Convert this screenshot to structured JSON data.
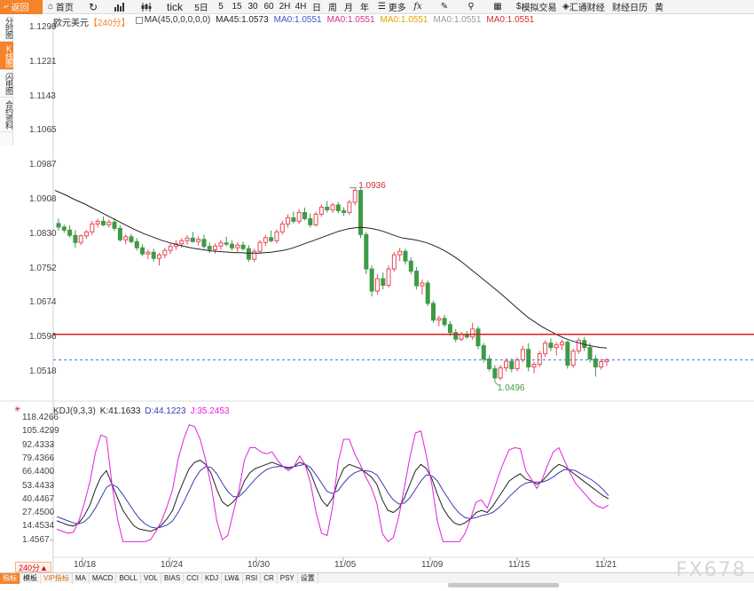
{
  "toolbar": {
    "back_label": "返回",
    "home_label": "首页",
    "tick_label": "tick",
    "periods": [
      "5日",
      "5",
      "15",
      "30",
      "60",
      "2H",
      "4H",
      "日",
      "周",
      "月",
      "年"
    ],
    "more_label": "更多",
    "fx_label": "fx",
    "sim_trade_label": "模拟交易",
    "huitong_label": "汇通财经",
    "calendar_label": "财经日历",
    "cut_label": "黄"
  },
  "sidebar": {
    "tabs": [
      "分时图",
      "K线图",
      "闪电图",
      "合约资料"
    ],
    "active_index": 1
  },
  "main_info": {
    "symbol": "欧元美元",
    "period": "【240分】",
    "ma_label": "MA(45,0,0,0,0,0)",
    "ma45": "MA45:1.0573",
    "ma0_1": "MA0:1.0551",
    "ma0_2": "MA0:1.0551",
    "ma0_3": "MA0:1.0551",
    "ma0_4": "MA0:1.0551",
    "ma0_5": "MA0:1.0551",
    "colors": {
      "ma45": "#222222",
      "ma0_1": "#3a56c5",
      "ma0_2": "#d0309a",
      "ma0_3": "#e5a000",
      "ma0_4": "#9a9a9a",
      "ma0_5": "#d03030"
    }
  },
  "kdj_info": {
    "name": "KDJ(9,3,3)",
    "k": "K:41.1633",
    "d": "D:44.1223",
    "j": "J:35.2453",
    "colors": {
      "k": "#222222",
      "d": "#3a3ab0",
      "j": "#e020e0"
    }
  },
  "price_axis": [
    "1.1299",
    "1.1221",
    "1.1143",
    "1.1065",
    "1.0987",
    "1.0908",
    "1.0830",
    "1.0752",
    "1.0674",
    "1.0596",
    "1.0518"
  ],
  "kdj_axis": [
    "118.4266",
    "105.4299",
    "92.4333",
    "79.4366",
    "66.4400",
    "53.4433",
    "40.4467",
    "27.4500",
    "14.4534",
    "1.4567"
  ],
  "date_axis": [
    "10/18",
    "10/24",
    "10/30",
    "11/05",
    "11/09",
    "11/15",
    "11/21"
  ],
  "annotations": {
    "high": "1.0936",
    "low": "1.0496"
  },
  "bottom_tabs": [
    "指标",
    "模板",
    "VIP指标",
    "MA",
    "MACD",
    "BOLL",
    "VOL",
    "BIAS",
    "CCI",
    "KDJ",
    "LW&",
    "RSI",
    "CR",
    "PSY",
    "设置"
  ],
  "period_tab": "240分▲",
  "watermark": "FX678",
  "colors": {
    "accent": "#f4832a",
    "up": "#e8485a",
    "down": "#3f9a45",
    "hline": "#d62020",
    "dashline": "#3a7fd0"
  },
  "chart_data": [
    {
      "type": "candlestick",
      "series_name": "欧元美元",
      "y_range": [
        1.0496,
        1.1299
      ],
      "high": 1.0936,
      "low": 1.0496,
      "horizontal_line": 1.0604,
      "dashed_line": 1.0546,
      "ohlc": [
        [
          1.0855,
          1.0866,
          1.0839,
          1.0847
        ],
        [
          1.0847,
          1.0852,
          1.0834,
          1.084
        ],
        [
          1.084,
          1.0851,
          1.0823,
          1.0828
        ],
        [
          1.0828,
          1.084,
          1.08,
          1.0812
        ],
        [
          1.0812,
          1.083,
          1.0806,
          1.0827
        ],
        [
          1.0827,
          1.084,
          1.082,
          1.0836
        ],
        [
          1.0836,
          1.0861,
          1.0829,
          1.0854
        ],
        [
          1.0854,
          1.0866,
          1.0846,
          1.086
        ],
        [
          1.086,
          1.0871,
          1.0849,
          1.0852
        ],
        [
          1.0852,
          1.0864,
          1.0846,
          1.0858
        ],
        [
          1.0858,
          1.0867,
          1.0838,
          1.0844
        ],
        [
          1.0844,
          1.0851,
          1.0814,
          1.0818
        ],
        [
          1.0818,
          1.0831,
          1.0808,
          1.0825
        ],
        [
          1.0825,
          1.0832,
          1.081,
          1.0814
        ],
        [
          1.0814,
          1.0822,
          1.0794,
          1.08
        ],
        [
          1.08,
          1.0808,
          1.0781,
          1.0786
        ],
        [
          1.0786,
          1.0796,
          1.0774,
          1.079
        ],
        [
          1.079,
          1.0798,
          1.0769,
          1.0776
        ],
        [
          1.0776,
          1.0788,
          1.076,
          1.0784
        ],
        [
          1.0784,
          1.08,
          1.0776,
          1.0794
        ],
        [
          1.0794,
          1.081,
          1.0786,
          1.0803
        ],
        [
          1.0803,
          1.0817,
          1.0795,
          1.0809
        ],
        [
          1.0809,
          1.0822,
          1.08,
          1.0816
        ],
        [
          1.0816,
          1.0829,
          1.0807,
          1.0822
        ],
        [
          1.0822,
          1.0836,
          1.0812,
          1.0814
        ],
        [
          1.0814,
          1.0826,
          1.0805,
          1.0819
        ],
        [
          1.0819,
          1.083,
          1.0798,
          1.0803
        ],
        [
          1.0803,
          1.0812,
          1.0788,
          1.0796
        ],
        [
          1.0796,
          1.081,
          1.0787,
          1.0804
        ],
        [
          1.0804,
          1.0818,
          1.0795,
          1.0811
        ],
        [
          1.0811,
          1.0825,
          1.0803,
          1.0808
        ],
        [
          1.0808,
          1.0817,
          1.0794,
          1.08
        ],
        [
          1.08,
          1.0812,
          1.079,
          1.0806
        ],
        [
          1.0806,
          1.0814,
          1.0794,
          1.0798
        ],
        [
          1.0798,
          1.0806,
          1.0768,
          1.0774
        ],
        [
          1.0774,
          1.0798,
          1.0768,
          1.0792
        ],
        [
          1.0792,
          1.0818,
          1.0786,
          1.0812
        ],
        [
          1.0812,
          1.0829,
          1.0804,
          1.0823
        ],
        [
          1.0823,
          1.0839,
          1.0812,
          1.0816
        ],
        [
          1.0816,
          1.0842,
          1.081,
          1.0836
        ],
        [
          1.0836,
          1.0861,
          1.083,
          1.0854
        ],
        [
          1.0854,
          1.0876,
          1.0846,
          1.0868
        ],
        [
          1.0868,
          1.0882,
          1.0855,
          1.086
        ],
        [
          1.086,
          1.0888,
          1.0854,
          1.088
        ],
        [
          1.088,
          1.0891,
          1.0862,
          1.0866
        ],
        [
          1.0866,
          1.0878,
          1.0846,
          1.0852
        ],
        [
          1.0852,
          1.0882,
          1.0848,
          1.0876
        ],
        [
          1.0876,
          1.0898,
          1.087,
          1.0892
        ],
        [
          1.0892,
          1.0906,
          1.088,
          1.0886
        ],
        [
          1.0886,
          1.0902,
          1.0879,
          1.0897
        ],
        [
          1.0897,
          1.0904,
          1.0878,
          1.0884
        ],
        [
          1.0884,
          1.0892,
          1.0872,
          1.088
        ],
        [
          1.088,
          1.0908,
          1.0875,
          1.0903
        ],
        [
          1.0903,
          1.0936,
          1.0896,
          1.093
        ],
        [
          1.093,
          1.0934,
          1.0822,
          1.083
        ],
        [
          1.083,
          1.0836,
          1.074,
          1.0752
        ],
        [
          1.0752,
          1.076,
          1.069,
          1.0702
        ],
        [
          1.0702,
          1.074,
          1.0694,
          1.073
        ],
        [
          1.073,
          1.0744,
          1.0706,
          1.0715
        ],
        [
          1.0715,
          1.076,
          1.071,
          1.0752
        ],
        [
          1.0752,
          1.079,
          1.0746,
          1.0784
        ],
        [
          1.0784,
          1.08,
          1.077,
          1.0792
        ],
        [
          1.0792,
          1.0798,
          1.0762,
          1.077
        ],
        [
          1.077,
          1.0778,
          1.074,
          1.0747
        ],
        [
          1.0747,
          1.0756,
          1.0706,
          1.0714
        ],
        [
          1.0714,
          1.0728,
          1.0694,
          1.072
        ],
        [
          1.072,
          1.0726,
          1.0668,
          1.0674
        ],
        [
          1.0674,
          1.068,
          1.063,
          1.0636
        ],
        [
          1.0636,
          1.0646,
          1.0622,
          1.064
        ],
        [
          1.064,
          1.0648,
          1.062,
          1.0626
        ],
        [
          1.0626,
          1.0634,
          1.06,
          1.0608
        ],
        [
          1.0608,
          1.0616,
          1.0586,
          1.0593
        ],
        [
          1.0593,
          1.061,
          1.0588,
          1.0604
        ],
        [
          1.0604,
          1.0612,
          1.0594,
          1.0598
        ],
        [
          1.0598,
          1.063,
          1.0592,
          1.0616
        ],
        [
          1.0616,
          1.0622,
          1.057,
          1.0578
        ],
        [
          1.0578,
          1.0584,
          1.054,
          1.0548
        ],
        [
          1.0548,
          1.0556,
          1.052,
          1.0526
        ],
        [
          1.0526,
          1.0534,
          1.0496,
          1.0505
        ],
        [
          1.0505,
          1.0534,
          1.05,
          1.0528
        ],
        [
          1.0528,
          1.055,
          1.052,
          1.0543
        ],
        [
          1.0543,
          1.055,
          1.0518,
          1.0526
        ],
        [
          1.0526,
          1.0552,
          1.052,
          1.0546
        ],
        [
          1.0546,
          1.0578,
          1.054,
          1.057
        ],
        [
          1.057,
          1.0584,
          1.052,
          1.053
        ],
        [
          1.053,
          1.0542,
          1.0516,
          1.0536
        ],
        [
          1.0536,
          1.0566,
          1.053,
          1.056
        ],
        [
          1.056,
          1.059,
          1.0552,
          1.0584
        ],
        [
          1.0584,
          1.0595,
          1.0566,
          1.0574
        ],
        [
          1.0574,
          1.0586,
          1.0556,
          1.058
        ],
        [
          1.058,
          1.0592,
          1.0568,
          1.0586
        ],
        [
          1.0586,
          1.059,
          1.0526,
          1.0534
        ],
        [
          1.0534,
          1.0572,
          1.0528,
          1.0566
        ],
        [
          1.0566,
          1.0596,
          1.056,
          1.059
        ],
        [
          1.059,
          1.0598,
          1.0566,
          1.0574
        ],
        [
          1.0574,
          1.0584,
          1.054,
          1.0548
        ],
        [
          1.0548,
          1.0556,
          1.0508,
          1.053
        ],
        [
          1.053,
          1.0548,
          1.0524,
          1.0542
        ],
        [
          1.0542,
          1.055,
          1.0532,
          1.0546
        ]
      ],
      "ma45": [
        1.093,
        1.0924,
        1.0918,
        1.0911,
        1.0905,
        1.0899,
        1.0892,
        1.0885,
        1.0878,
        1.0871,
        1.0864,
        1.0857,
        1.085,
        1.0843,
        1.0837,
        1.0831,
        1.0826,
        1.0821,
        1.0816,
        1.0812,
        1.0808,
        1.0805,
        1.0802,
        1.0799,
        1.0797,
        1.0795,
        1.0793,
        1.0792,
        1.0791,
        1.079,
        1.0789,
        1.0789,
        1.0788,
        1.0788,
        1.0788,
        1.0789,
        1.079,
        1.0792,
        1.0794,
        1.0797,
        1.0801,
        1.0806,
        1.0811,
        1.0816,
        1.0821,
        1.0826,
        1.0831,
        1.0836,
        1.084,
        1.0843,
        1.0845,
        1.0846,
        1.0845,
        1.0843,
        1.084,
        1.0836,
        1.0831,
        1.0826,
        1.0822,
        1.082,
        1.0818,
        1.0815,
        1.0811,
        1.0806,
        1.08,
        1.0793,
        1.0785,
        1.0776,
        1.0766,
        1.0755,
        1.0744,
        1.0733,
        1.0722,
        1.0711,
        1.07,
        1.0688,
        1.0676,
        1.0664,
        1.0652,
        1.0641,
        1.0632,
        1.0623,
        1.0615,
        1.0608,
        1.0601,
        1.0595,
        1.059,
        1.0586,
        1.0582,
        1.0579,
        1.0576,
        1.0574,
        1.0573
      ]
    },
    {
      "type": "line",
      "series_name": "KDJ(9,3,3)",
      "y_range": [
        1.4567,
        118.4266
      ],
      "series": [
        {
          "name": "K",
          "values": [
            20,
            18,
            16,
            15,
            18,
            25,
            35,
            50,
            62,
            68,
            55,
            42,
            30,
            22,
            15,
            12,
            11,
            10,
            12,
            16,
            22,
            30,
            45,
            58,
            70,
            76,
            78,
            74,
            65,
            50,
            38,
            34,
            38,
            45,
            58,
            66,
            70,
            72,
            74,
            76,
            74,
            72,
            70,
            72,
            76,
            74,
            66,
            52,
            40,
            34,
            42,
            58,
            70,
            74,
            72,
            70,
            66,
            62,
            55,
            40,
            30,
            28,
            32,
            42,
            55,
            68,
            74,
            70,
            60,
            45,
            32,
            24,
            18,
            16,
            18,
            22,
            28,
            30,
            28,
            34,
            42,
            50,
            58,
            62,
            65,
            60,
            58,
            55,
            58,
            64,
            70,
            74,
            72,
            68,
            64,
            60,
            56,
            52,
            48,
            44,
            41
          ]
        },
        {
          "name": "D",
          "values": [
            24,
            22,
            20,
            18,
            17,
            19,
            24,
            32,
            42,
            52,
            55,
            52,
            45,
            37,
            29,
            22,
            17,
            14,
            13,
            14,
            16,
            20,
            28,
            38,
            49,
            60,
            68,
            72,
            71,
            65,
            56,
            48,
            43,
            43,
            48,
            54,
            60,
            65,
            69,
            71,
            72,
            72,
            71,
            72,
            73,
            74,
            71,
            64,
            56,
            48,
            46,
            49,
            56,
            62,
            66,
            68,
            68,
            67,
            64,
            56,
            47,
            40,
            36,
            37,
            42,
            50,
            58,
            64,
            63,
            58,
            49,
            41,
            33,
            27,
            23,
            22,
            23,
            25,
            26,
            28,
            32,
            37,
            43,
            48,
            53,
            56,
            57,
            57,
            57,
            59,
            62,
            66,
            69,
            69,
            68,
            65,
            62,
            59,
            55,
            50,
            44
          ]
        },
        {
          "name": "J",
          "values": [
            12,
            10,
            8,
            9,
            20,
            37,
            57,
            85,
            102,
            100,
            55,
            22,
            0,
            0,
            0,
            0,
            0,
            2,
            10,
            20,
            34,
            50,
            79,
            98,
            112,
            110,
            98,
            78,
            53,
            20,
            2,
            6,
            28,
            49,
            78,
            90,
            90,
            86,
            84,
            86,
            78,
            72,
            68,
            72,
            82,
            74,
            56,
            28,
            8,
            6,
            34,
            76,
            98,
            98,
            84,
            74,
            62,
            52,
            37,
            8,
            0,
            4,
            24,
            52,
            81,
            104,
            106,
            82,
            54,
            19,
            0,
            0,
            0,
            0,
            8,
            22,
            38,
            40,
            32,
            46,
            62,
            76,
            88,
            90,
            89,
            68,
            60,
            51,
            60,
            74,
            86,
            90,
            78,
            66,
            56,
            50,
            44,
            38,
            34,
            32,
            35
          ]
        }
      ]
    }
  ]
}
